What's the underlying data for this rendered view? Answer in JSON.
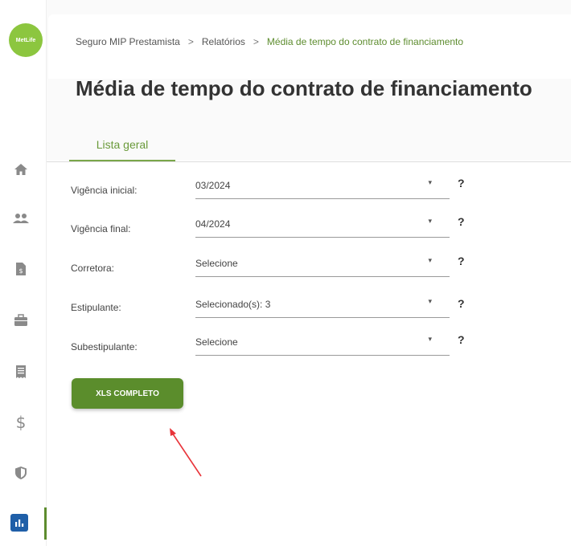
{
  "brand": {
    "logo_text": "MetLife",
    "accent": "#5b8d2c",
    "annotation_color": "#e8343a"
  },
  "sidebar": {
    "items": [
      {
        "name": "home-icon"
      },
      {
        "name": "users-icon"
      },
      {
        "name": "document-dollar-icon"
      },
      {
        "name": "briefcase-icon"
      },
      {
        "name": "receipt-icon"
      },
      {
        "name": "dollar-icon"
      },
      {
        "name": "shield-icon"
      },
      {
        "name": "bar-chart-icon",
        "active": true
      }
    ]
  },
  "breadcrumb": {
    "items": [
      "Seguro MIP Prestamista",
      "Relatórios",
      "Média de tempo do contrato de financiamento"
    ],
    "separator": ">"
  },
  "page": {
    "title": "Média de tempo do contrato de financiamento"
  },
  "tabs": [
    {
      "label": "Lista geral",
      "active": true
    }
  ],
  "filters": [
    {
      "label": "Vigência inicial:",
      "value": "03/2024",
      "help": "?"
    },
    {
      "label": "Vigência final:",
      "value": "04/2024",
      "help": "?"
    },
    {
      "label": "Corretora:",
      "value": "Selecione",
      "help": "?"
    },
    {
      "label": "Estipulante:",
      "value": "Selecionado(s): 3",
      "help": "?"
    },
    {
      "label": "Subestipulante:",
      "value": "Selecione",
      "help": "?"
    }
  ],
  "caret": "▾",
  "actions": {
    "xls_label": "XLS COMPLETO"
  }
}
